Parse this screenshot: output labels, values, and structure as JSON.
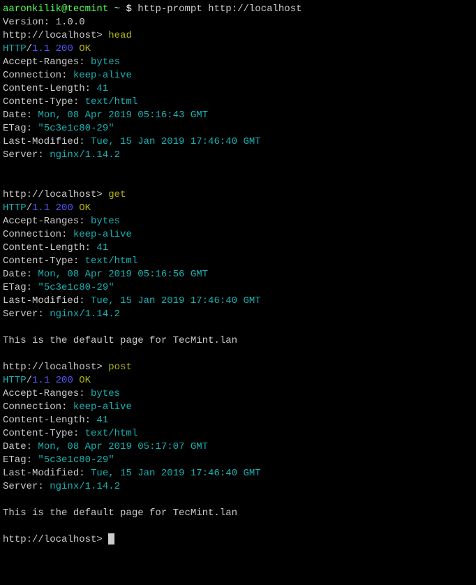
{
  "shell": {
    "user_host": "aaronkilik@tecmint",
    "path": " ~ ",
    "prompt_sym": "$ ",
    "command": "http-prompt http://localhost"
  },
  "version_line": "Version: 1.0.0",
  "prompt_url": "http://localhost> ",
  "cmd_head": "head",
  "cmd_get": "get",
  "cmd_post": "post",
  "status": {
    "http": "HTTP",
    "slash": "/",
    "ver": "1.1",
    "sp": " ",
    "code": "200",
    "ok": "OK"
  },
  "headers": {
    "accept_ranges_k": "Accept-Ranges: ",
    "accept_ranges_v": "bytes",
    "connection_k": "Connection: ",
    "connection_v": "keep-alive",
    "content_length_k": "Content-Length: ",
    "content_length_v": "41",
    "content_type_k": "Content-Type: ",
    "content_type_v": "text/html",
    "date_k": "Date: ",
    "date_head_v": "Mon, 08 Apr 2019 05:16:43 GMT",
    "date_get_v": "Mon, 08 Apr 2019 05:16:56 GMT",
    "date_post_v": "Mon, 08 Apr 2019 05:17:07 GMT",
    "etag_k": "ETag: ",
    "etag_v": "\"5c3e1c80-29\"",
    "last_modified_k": "Last-Modified: ",
    "last_modified_v": "Tue, 15 Jan 2019 17:46:40 GMT",
    "server_k": "Server: ",
    "server_v": "nginx/1.14.2"
  },
  "body_text": "This is the default page for TecMint.lan"
}
